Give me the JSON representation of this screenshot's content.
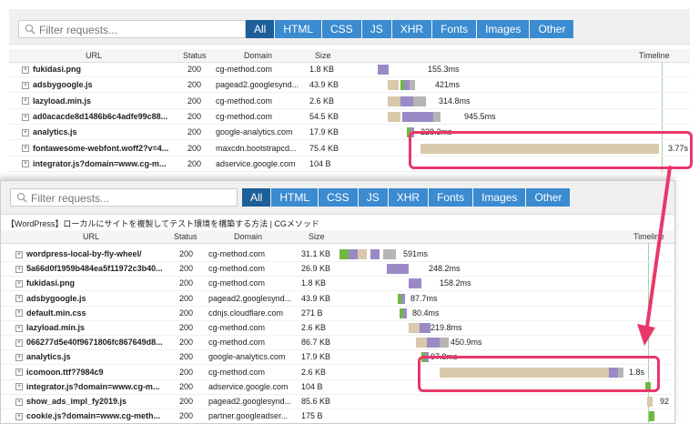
{
  "search": {
    "placeholder": "Filter requests..."
  },
  "filters": [
    "All",
    "HTML",
    "CSS",
    "JS",
    "XHR",
    "Fonts",
    "Images",
    "Other"
  ],
  "columns": {
    "url": "URL",
    "status": "Status",
    "domain": "Domain",
    "size": "Size",
    "timeline": "Timeline"
  },
  "panel1": {
    "rows": [
      {
        "url": "fukidasi.png",
        "status": "200",
        "domain": "cg-method.com",
        "size": "1.8 KB",
        "time": "155.3ms"
      },
      {
        "url": "adsbygoogle.js",
        "status": "200",
        "domain": "pagead2.googlesynd...",
        "size": "43.9 KB",
        "time": "421ms"
      },
      {
        "url": "lazyload.min.js",
        "status": "200",
        "domain": "cg-method.com",
        "size": "2.6 KB",
        "time": "314.8ms"
      },
      {
        "url": "ad0acacde8d1486b6c4adfe99c88...",
        "status": "200",
        "domain": "cg-method.com",
        "size": "54.5 KB",
        "time": "945.5ms"
      },
      {
        "url": "analytics.js",
        "status": "200",
        "domain": "google-analytics.com",
        "size": "17.9 KB",
        "time": "228.3ms"
      },
      {
        "url": "fontawesome-webfont.woff2?v=4...",
        "status": "200",
        "domain": "maxcdn.bootstrapcd...",
        "size": "75.4 KB",
        "time": "3.77s"
      },
      {
        "url": "integrator.js?domain=www.cg-m...",
        "status": "200",
        "domain": "adservice.google.com",
        "size": "104 B",
        "time": ""
      }
    ]
  },
  "panel2": {
    "page_title": "【WordPress】ローカルにサイトを複製してテスト環境を構築する方法 | CGメソッド",
    "rows": [
      {
        "url": "wordpress-local-by-fly-wheel/",
        "status": "200",
        "domain": "cg-method.com",
        "size": "31.1 KB",
        "time": "591ms"
      },
      {
        "url": "5a66d0f1959b484ea5f11972c3b40...",
        "status": "200",
        "domain": "cg-method.com",
        "size": "26.9 KB",
        "time": "248.2ms"
      },
      {
        "url": "fukidasi.png",
        "status": "200",
        "domain": "cg-method.com",
        "size": "1.8 KB",
        "time": "158.2ms"
      },
      {
        "url": "adsbygoogle.js",
        "status": "200",
        "domain": "pagead2.googlesynd...",
        "size": "43.9 KB",
        "time": "87.7ms"
      },
      {
        "url": "default.min.css",
        "status": "200",
        "domain": "cdnjs.cloudflare.com",
        "size": "271 B",
        "time": "80.4ms"
      },
      {
        "url": "lazyload.min.js",
        "status": "200",
        "domain": "cg-method.com",
        "size": "2.6 KB",
        "time": "219.8ms"
      },
      {
        "url": "066277d5e40f9671806fc867649d8...",
        "status": "200",
        "domain": "cg-method.com",
        "size": "86.7 KB",
        "time": "450.9ms"
      },
      {
        "url": "analytics.js",
        "status": "200",
        "domain": "google-analytics.com",
        "size": "17.9 KB",
        "time": "97.8ms"
      },
      {
        "url": "icomoon.ttf?7984c9",
        "status": "200",
        "domain": "cg-method.com",
        "size": "2.6 KB",
        "time": "1.8s"
      },
      {
        "url": "integrator.js?domain=www.cg-m...",
        "status": "200",
        "domain": "adservice.google.com",
        "size": "104 B",
        "time": ""
      },
      {
        "url": "show_ads_impl_fy2019.js",
        "status": "200",
        "domain": "pagead2.googlesynd...",
        "size": "85.6 KB",
        "time": "92"
      },
      {
        "url": "cookie.js?domain=www.cg-meth...",
        "status": "200",
        "domain": "partner.googleadser...",
        "size": "175 B",
        "time": ""
      }
    ]
  },
  "colors": {
    "filter": "#3b8bd0",
    "filter_active": "#1d5f99",
    "highlight": "#e8386a",
    "wait": "#d9c8a9",
    "receive": "#9b8ac8",
    "blocked": "#b5b5b5",
    "connect": "#6fb840"
  }
}
